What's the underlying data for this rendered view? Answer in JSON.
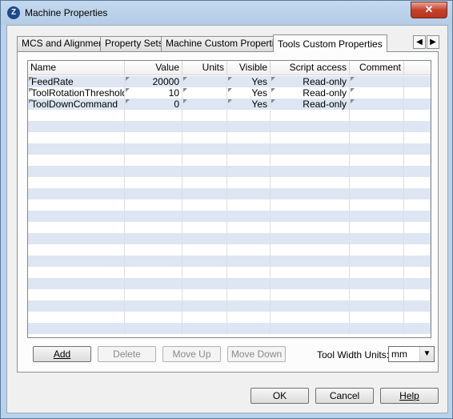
{
  "window": {
    "title": "Machine Properties",
    "close_glyph": "✕",
    "app_icon": "Z"
  },
  "tabs": [
    "MCS and Alignment",
    "Property Sets",
    "Machine Custom Properties",
    "Tools Custom Properties"
  ],
  "active_tab": "Tools Custom Properties",
  "tab_scroll": {
    "left": "◀",
    "right": "▶"
  },
  "grid": {
    "columns": [
      "Name",
      "Value",
      "Units",
      "Visible",
      "Script access",
      "Comment"
    ],
    "rows": [
      {
        "name": "FeedRate",
        "value": "20000",
        "units": "",
        "visible": "Yes",
        "script_access": "Read-only",
        "comment": ""
      },
      {
        "name": "ToolRotationThreshold",
        "value": "10",
        "units": "",
        "visible": "Yes",
        "script_access": "Read-only",
        "comment": ""
      },
      {
        "name": "ToolDownCommand",
        "value": "0",
        "units": "",
        "visible": "Yes",
        "script_access": "Read-only",
        "comment": ""
      }
    ]
  },
  "actions": {
    "add": "Add",
    "delete": "Delete",
    "move_up": "Move Up",
    "move_down": "Move Down"
  },
  "tool_width": {
    "label": "Tool Width Units:",
    "value": "mm"
  },
  "footer": {
    "ok": "OK",
    "cancel": "Cancel",
    "help": "Help"
  },
  "colors": {
    "row_stripe": "#dde6f2",
    "grid_line": "#d8dfe8",
    "title_bar": "#b9d1ea"
  }
}
